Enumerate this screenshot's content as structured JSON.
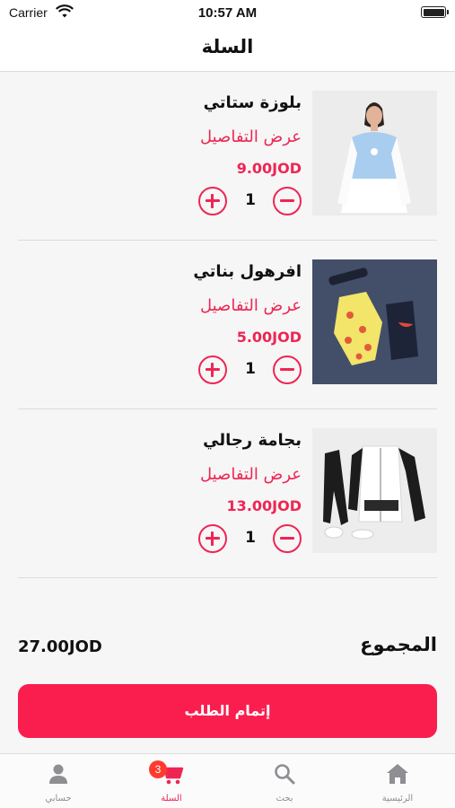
{
  "status_bar": {
    "carrier": "Carrier",
    "time": "10:57 AM"
  },
  "header": {
    "title": "السلة"
  },
  "cart": {
    "details_label": "عرض التفاصيل",
    "items": [
      {
        "name": "بلوزة ستاتي",
        "price": "9.00JOD",
        "quantity": "1"
      },
      {
        "name": "افرهول بناتي",
        "price": "5.00JOD",
        "quantity": "1"
      },
      {
        "name": "بجامة رجالي",
        "price": "13.00JOD",
        "quantity": "1"
      }
    ]
  },
  "summary": {
    "total_label": "المجموع",
    "total_value": "27.00JOD"
  },
  "checkout_label": "إتمام الطلب",
  "tab_bar": {
    "tabs": [
      {
        "label": "حسابي",
        "icon": "person-icon"
      },
      {
        "label": "السلة",
        "icon": "cart-icon",
        "badge": "3"
      },
      {
        "label": "بحث",
        "icon": "search-icon"
      },
      {
        "label": "الرئيسية",
        "icon": "home-icon"
      }
    ]
  },
  "colors": {
    "accent": "#ee2553",
    "button": "#fa1e4e",
    "badge": "#ff3b30"
  }
}
